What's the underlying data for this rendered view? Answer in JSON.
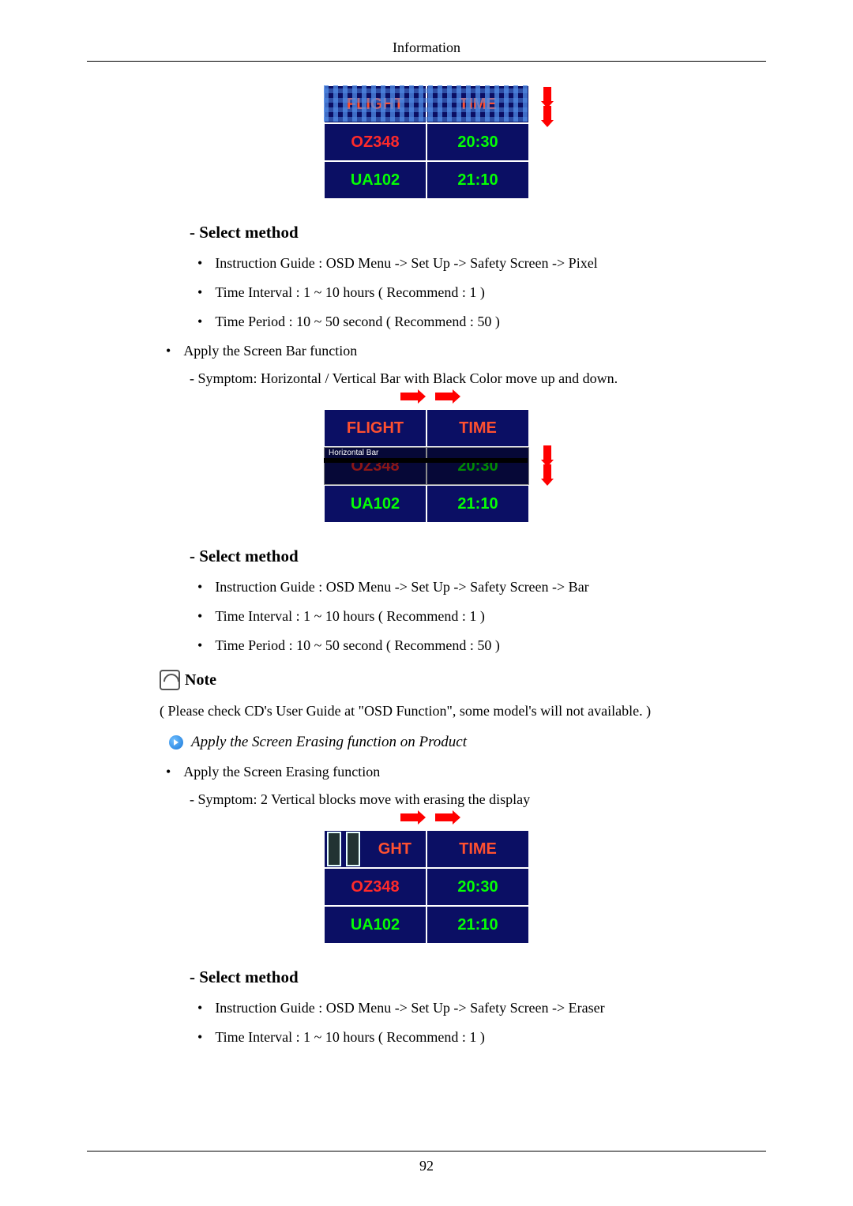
{
  "header": {
    "title": "Information"
  },
  "flight": {
    "head": {
      "c1": "FLIGHT",
      "c2": "TIME"
    },
    "rows": [
      {
        "c1": "OZ348",
        "c2": "20:30"
      },
      {
        "c1": "UA102",
        "c2": "21:10"
      }
    ]
  },
  "section_pixel": {
    "heading": "- Select method",
    "items": [
      "Instruction Guide : OSD Menu -> Set Up -> Safety Screen -> Pixel",
      "Time Interval : 1 ~ 10 hours ( Recommend : 1 )",
      "Time Period : 10 ~ 50 second ( Recommend : 50 )"
    ]
  },
  "apply_bar": {
    "bullet": "Apply the Screen Bar function",
    "symptom": "- Symptom: Horizontal / Vertical Bar with Black Color move up and down."
  },
  "hbar_label": "Horizontal Bar",
  "section_bar": {
    "heading": "- Select method",
    "items": [
      "Instruction Guide : OSD Menu -> Set Up -> Safety Screen -> Bar",
      "Time Interval : 1 ~ 10 hours ( Recommend : 1 )",
      "Time Period : 10 ~ 50 second ( Recommend : 50 )"
    ]
  },
  "note": {
    "label": "Note",
    "para": "( Please check CD's User Guide at \"OSD Function\", some model's will not available. )"
  },
  "erasing": {
    "title": "Apply the Screen Erasing function on Product",
    "bullet": "Apply the Screen Erasing function",
    "symptom": "- Symptom: 2 Vertical blocks move with erasing the display",
    "head_partial": "GHT"
  },
  "section_eraser": {
    "heading": "- Select method",
    "items": [
      "Instruction Guide : OSD Menu -> Set Up -> Safety Screen -> Eraser",
      "Time Interval : 1 ~ 10 hours ( Recommend : 1 )"
    ]
  },
  "footer": {
    "page": "92"
  }
}
